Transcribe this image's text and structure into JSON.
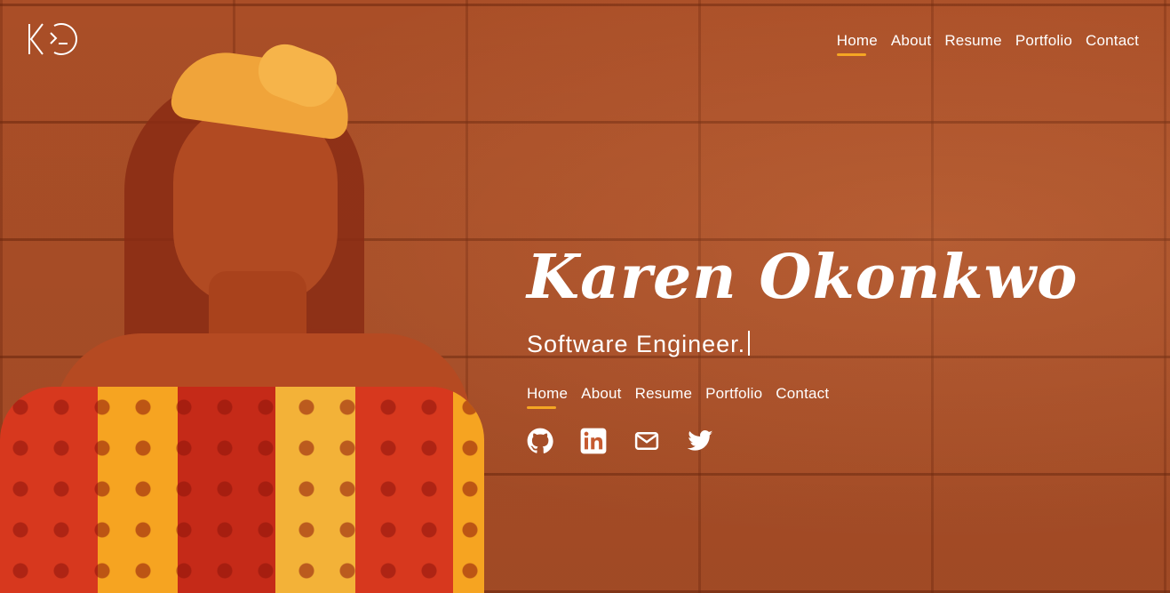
{
  "colors": {
    "accent": "#f5a623",
    "overlay": "#d2693a",
    "text": "#ffffff"
  },
  "logo": {
    "icon": "ko-terminal-logo"
  },
  "topnav": [
    {
      "label": "Home",
      "active": true
    },
    {
      "label": "About",
      "active": false
    },
    {
      "label": "Resume",
      "active": false
    },
    {
      "label": "Portfolio",
      "active": false
    },
    {
      "label": "Contact",
      "active": false
    }
  ],
  "hero": {
    "name": "Karen Okonkwo",
    "subtitle": "Software Engineer."
  },
  "heronav": [
    {
      "label": "Home",
      "active": true
    },
    {
      "label": "About",
      "active": false
    },
    {
      "label": "Resume",
      "active": false
    },
    {
      "label": "Portfolio",
      "active": false
    },
    {
      "label": "Contact",
      "active": false
    }
  ],
  "social": [
    "github-icon",
    "linkedin-icon",
    "mail-icon",
    "twitter-icon"
  ]
}
